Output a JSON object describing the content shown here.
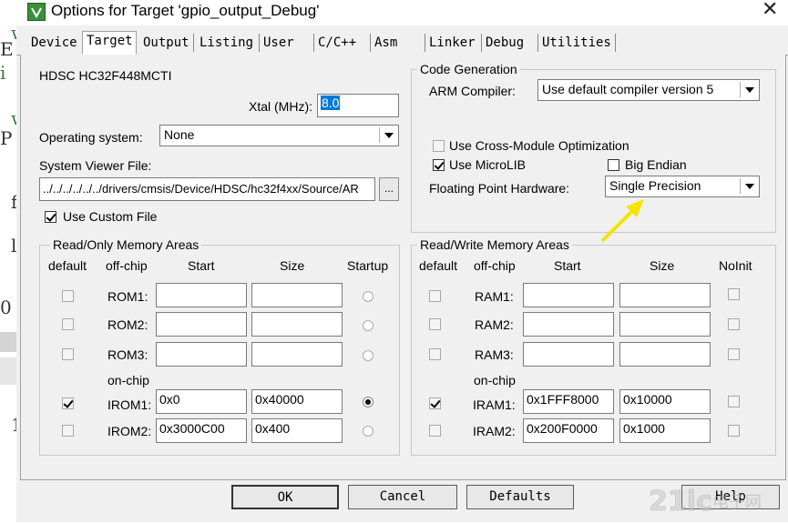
{
  "window": {
    "title": "Options for Target 'gpio_output_Debug'"
  },
  "tabs": [
    "Device",
    "Target",
    "Output",
    "Listing",
    "User",
    "C/C++",
    "Asm",
    "Linker",
    "Debug",
    "Utilities"
  ],
  "device": {
    "name": "HDSC HC32F448MCTI",
    "xtal_label": "Xtal (MHz):",
    "xtal_value": "8.0",
    "os_label": "Operating system:",
    "os_value": "None",
    "svf_label": "System Viewer File:",
    "svf_value": "../../../../../../drivers/cmsis/Device/HDSC/hc32f4xx/Source/AR",
    "browse_label": "...",
    "custom_file_label": "Use Custom File",
    "custom_file_checked": true
  },
  "codegen": {
    "title": "Code Generation",
    "compiler_label": "ARM Compiler:",
    "compiler_value": "Use default compiler version 5",
    "cross_module_label": "Use Cross-Module Optimization",
    "cross_module_checked": false,
    "microlib_label": "Use MicroLIB",
    "microlib_checked": true,
    "big_endian_label": "Big Endian",
    "big_endian_checked": false,
    "fph_label": "Floating Point Hardware:",
    "fph_value": "Single Precision"
  },
  "ro_memory": {
    "title": "Read/Only Memory Areas",
    "headers": {
      "default": "default",
      "offchip": "off-chip",
      "start": "Start",
      "size": "Size",
      "startup": "Startup"
    },
    "offchip_rows": [
      {
        "label": "ROM1:",
        "start": "",
        "size": ""
      },
      {
        "label": "ROM2:",
        "start": "",
        "size": ""
      },
      {
        "label": "ROM3:",
        "start": "",
        "size": ""
      }
    ],
    "onchip_label": "on-chip",
    "onchip_rows": [
      {
        "label": "IROM1:",
        "start": "0x0",
        "size": "0x40000",
        "default": true,
        "startup": true
      },
      {
        "label": "IROM2:",
        "start": "0x3000C00",
        "size": "0x400",
        "default": false,
        "startup": false
      }
    ]
  },
  "rw_memory": {
    "title": "Read/Write Memory Areas",
    "headers": {
      "default": "default",
      "offchip": "off-chip",
      "start": "Start",
      "size": "Size",
      "noinit": "NoInit"
    },
    "offchip_rows": [
      {
        "label": "RAM1:",
        "start": "",
        "size": ""
      },
      {
        "label": "RAM2:",
        "start": "",
        "size": ""
      },
      {
        "label": "RAM3:",
        "start": "",
        "size": ""
      }
    ],
    "onchip_label": "on-chip",
    "onchip_rows": [
      {
        "label": "IRAM1:",
        "start": "0x1FFF8000",
        "size": "0x10000",
        "default": true
      },
      {
        "label": "IRAM2:",
        "start": "0x200F0000",
        "size": "0x1000",
        "default": false
      }
    ]
  },
  "buttons": {
    "ok": "OK",
    "cancel": "Cancel",
    "defaults": "Defaults",
    "help": "Help"
  },
  "colors": {
    "arrow": "#f5e400",
    "selection": "#0078d7",
    "dialog_bg": "#f0f0f0"
  },
  "watermark": {
    "text": "21ic电子网"
  }
}
